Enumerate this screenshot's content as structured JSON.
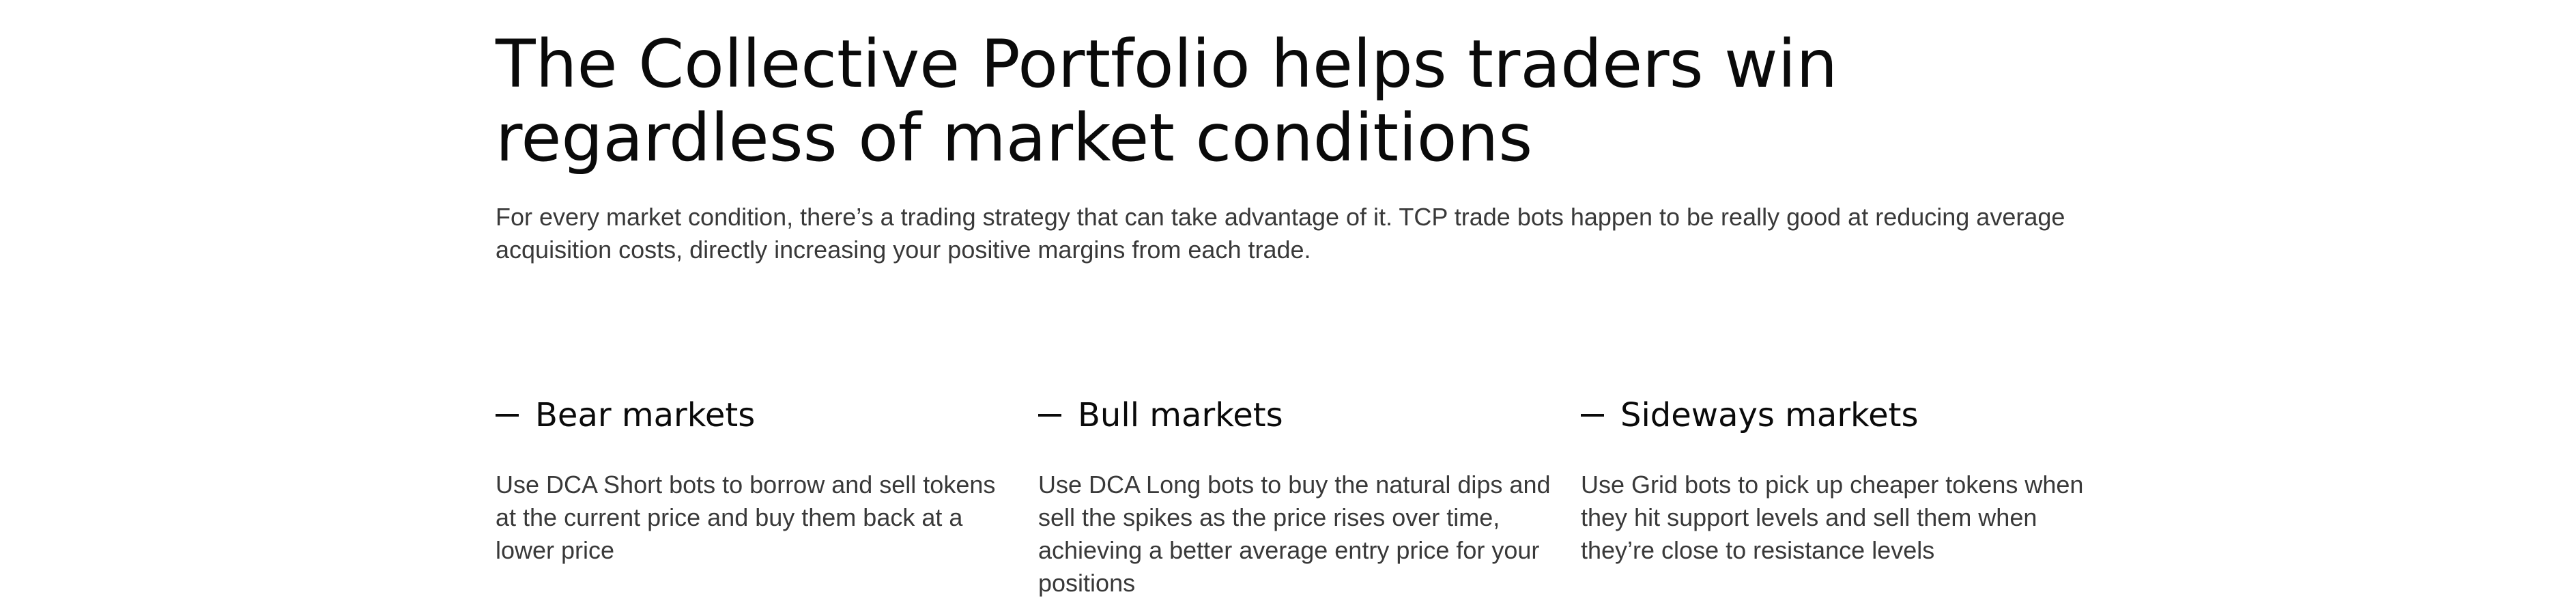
{
  "hero": {
    "title": "The Collective Portfolio helps traders win regardless of market conditions",
    "description": "For every market condition, there’s a trading strategy that can take advantage of it. TCP trade bots happen to be really good at reducing average acquisition costs, directly increasing your positive margins from each trade."
  },
  "markets": [
    {
      "title": "Bear markets",
      "body": "Use DCA Short bots to borrow and sell tokens at the current price and buy them back at a lower price"
    },
    {
      "title": "Bull markets",
      "body": "Use DCA Long bots to buy the natural dips and sell the spikes as the price rises over time, achieving a better average entry price for your positions"
    },
    {
      "title": "Sideways markets",
      "body": "Use Grid bots to pick up cheaper tokens when they hit support levels and sell them when they’re close to resistance levels"
    }
  ]
}
